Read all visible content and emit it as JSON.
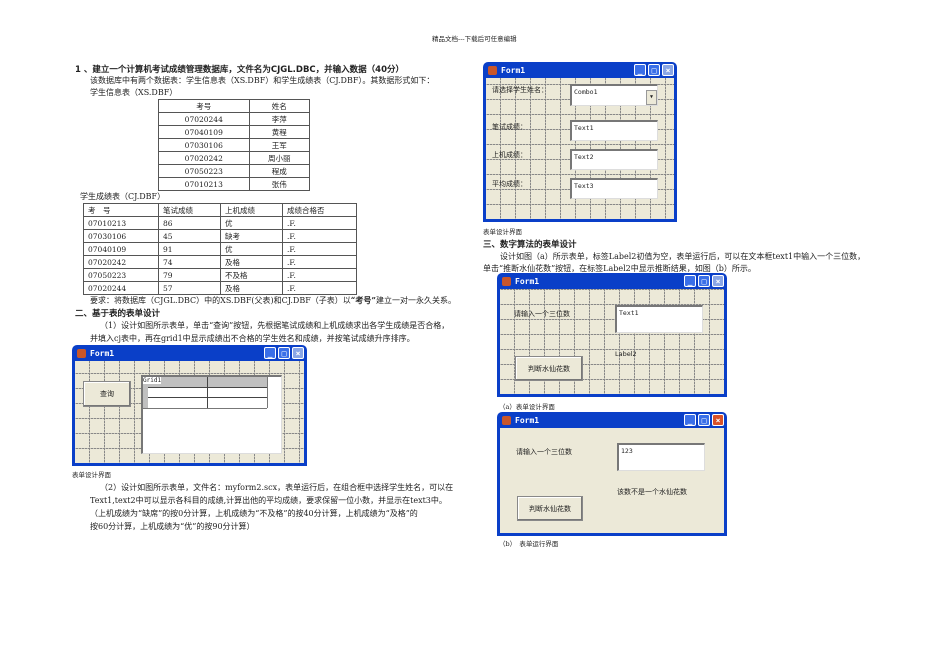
{
  "header": "精品文档---下载后可任意编辑",
  "s1": {
    "heading": "1 、建立一个计算机考试成绩管理数据库，文件名为CJGL.DBC，并输入数据（40分）",
    "intro": "该数据库中有两个数据表：学生信息表（XS.DBF）和学生成绩表（CJ.DBF）。其数据形式如下：",
    "xs_title": "学生信息表（XS.DBF）",
    "xs_headers": [
      "考号",
      "姓名"
    ],
    "xs_rows": [
      [
        "07020244",
        "李萍"
      ],
      [
        "07040109",
        "黄程"
      ],
      [
        "07030106",
        "王军"
      ],
      [
        "07020242",
        "周小丽"
      ],
      [
        "07050223",
        "程成"
      ],
      [
        "07010213",
        "张伟"
      ]
    ],
    "cj_title": "学生成绩表（CJ.DBF）",
    "cj_headers": [
      "考　号",
      "笔试成绩",
      "上机成绩",
      "成绩合格否"
    ],
    "cj_rows": [
      [
        "07010213",
        "86",
        "优",
        ".F."
      ],
      [
        "07030106",
        "45",
        "缺考",
        ".F."
      ],
      [
        "07040109",
        "91",
        "优",
        ".F."
      ],
      [
        "07020242",
        "74",
        "及格",
        ".F."
      ],
      [
        "07050223",
        "79",
        "不及格",
        ".F."
      ],
      [
        "07020244",
        "57",
        "及格",
        ".F."
      ]
    ],
    "req_a": "要求：将数据库（CJGL.DBC）中的XS.DBF(父表)和CJ.DBF（子表）以",
    "req_b": "“考号”",
    "req_c": "建立一对一永久关系。"
  },
  "s2": {
    "heading": "二、基于表的表单设计",
    "p1": [
      "（1）设计如图所示表单，单击“查询”按钮，先根据笔试成绩和上机成绩求出各学生成绩是否合格，",
      "并填入cj表中，再在grid1中显示成绩出不合格的学生姓名和成绩，并按笔试成绩升序排序。"
    ],
    "form1": {
      "title": "Form1",
      "query_button": "查询",
      "grid_label": "Grid1"
    },
    "caption1": "表单设计界面",
    "p2": [
      "（2）设计如图所示表单，文件名：myform2.scx，表单运行后，在组合框中选择学生姓名，可以在",
      "Text1,text2中可以显示各科目的成绩,计算出他的平均成绩，要求保留一位小数，并显示在text3中。",
      "（上机成绩为“缺席”的按0分计算，上机成绩为“不及格”的按40分计算，上机成绩为“及格”的",
      "按60分计算，上机成绩为“优”的按90分计算）"
    ],
    "form2": {
      "title": "Form1",
      "labels": [
        "请选择学生姓名：",
        "笔试成绩：",
        "上机成绩：",
        "平均成绩："
      ],
      "combo": "Combo1",
      "texts": [
        "Text1",
        "Text2",
        "Text3"
      ]
    },
    "caption2": "表单设计界面"
  },
  "s3": {
    "heading": "三、数字算法的表单设计",
    "p": [
      "设计如图（a）所示表单，标签Label2初值为空，表单运行后，可以在文本框text1中输入一个三位数，",
      "单击“推断水仙花数”按钮，在标签Label2中显示推断结果，如图（b）所示。"
    ],
    "forma": {
      "title": "Form1",
      "prompt": "请输入一个三位数",
      "text": "Text1",
      "label": "Label2",
      "button": "判断水仙花数"
    },
    "caption_a": "（a）表单设计界面",
    "formb": {
      "title": "Form1",
      "prompt": "请输入一个三位数",
      "text": "123",
      "result": "该数不是一个水仙花数",
      "button": "判断水仙花数"
    },
    "caption_b": "（b）　表单运行界面"
  }
}
